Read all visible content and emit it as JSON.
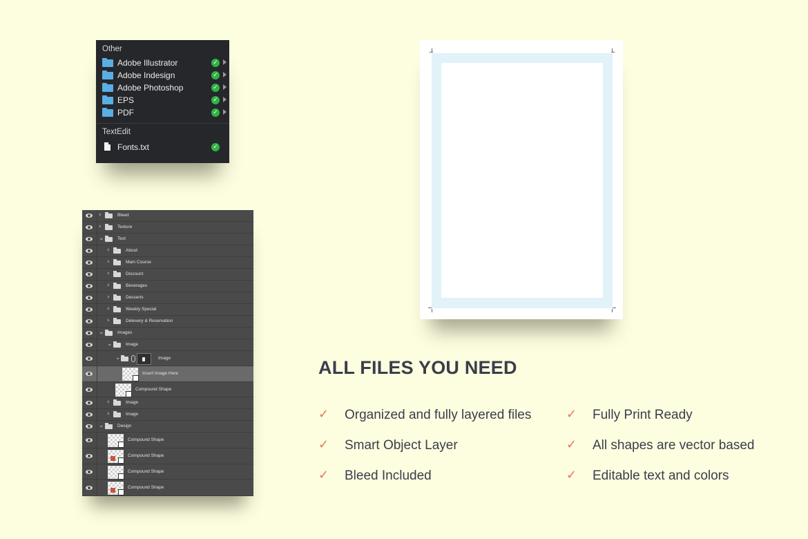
{
  "finder": {
    "section_other": "Other",
    "items": [
      {
        "label": "Adobe Illustrator",
        "icon": "folder-icon",
        "status": "check"
      },
      {
        "label": "Adobe Indesign",
        "icon": "folder-icon",
        "status": "check"
      },
      {
        "label": "Adobe Photoshop",
        "icon": "folder-icon",
        "status": "check"
      },
      {
        "label": "EPS",
        "icon": "folder-icon",
        "status": "check"
      },
      {
        "label": "PDF",
        "icon": "folder-icon",
        "status": "check"
      }
    ],
    "section_textedit": "TextEdit",
    "file": {
      "label": "Fonts.txt",
      "icon": "document-icon",
      "status": "check"
    }
  },
  "layers": [
    {
      "name": "Bleed",
      "depth": 0,
      "kind": "folder",
      "expanded": false
    },
    {
      "name": "Texture",
      "depth": 0,
      "kind": "folder",
      "expanded": false
    },
    {
      "name": "Text",
      "depth": 0,
      "kind": "folder",
      "expanded": true
    },
    {
      "name": "About",
      "depth": 1,
      "kind": "folder",
      "expanded": false
    },
    {
      "name": "Main Course",
      "depth": 1,
      "kind": "folder",
      "expanded": false
    },
    {
      "name": "Discount",
      "depth": 1,
      "kind": "folder",
      "expanded": false
    },
    {
      "name": "Beverages",
      "depth": 1,
      "kind": "folder",
      "expanded": false
    },
    {
      "name": "Desserts",
      "depth": 1,
      "kind": "folder",
      "expanded": false
    },
    {
      "name": "Weekly Special",
      "depth": 1,
      "kind": "folder",
      "expanded": false
    },
    {
      "name": "Delevery & Reservation",
      "depth": 1,
      "kind": "folder",
      "expanded": false
    },
    {
      "name": "Images",
      "depth": 0,
      "kind": "folder",
      "expanded": true
    },
    {
      "name": "Image",
      "depth": 1,
      "kind": "folder",
      "expanded": true
    },
    {
      "name": "Image",
      "depth": 2,
      "kind": "maskfolder",
      "expanded": true
    },
    {
      "name": "Insert Image Here",
      "depth": 3,
      "kind": "smartobject",
      "selected": true
    },
    {
      "name": "Compound Shape",
      "depth": 2,
      "kind": "shape"
    },
    {
      "name": "Image",
      "depth": 1,
      "kind": "folder",
      "expanded": false
    },
    {
      "name": "Image",
      "depth": 1,
      "kind": "folder",
      "expanded": false
    },
    {
      "name": "Design",
      "depth": 0,
      "kind": "folder",
      "expanded": true
    },
    {
      "name": "Compound Shape",
      "depth": 1,
      "kind": "shape"
    },
    {
      "name": "Compound Shape",
      "depth": 1,
      "kind": "shape",
      "accent": true
    },
    {
      "name": "Compound Shape",
      "depth": 1,
      "kind": "shape"
    },
    {
      "name": "Compound Shape",
      "depth": 1,
      "kind": "shape",
      "accent": true
    }
  ],
  "features": {
    "heading": "ALL FILES YOU NEED",
    "left": [
      "Organized and fully layered files",
      "Smart Object Layer",
      "Bleed Included"
    ],
    "right": [
      "Fully Print Ready",
      "All shapes are vector based",
      "Editable text and colors"
    ]
  },
  "colors": {
    "background": "#fdfde0",
    "accent_check": "#e8755c",
    "bleed": "#e1f2f9",
    "finder_check": "#2fb345"
  }
}
